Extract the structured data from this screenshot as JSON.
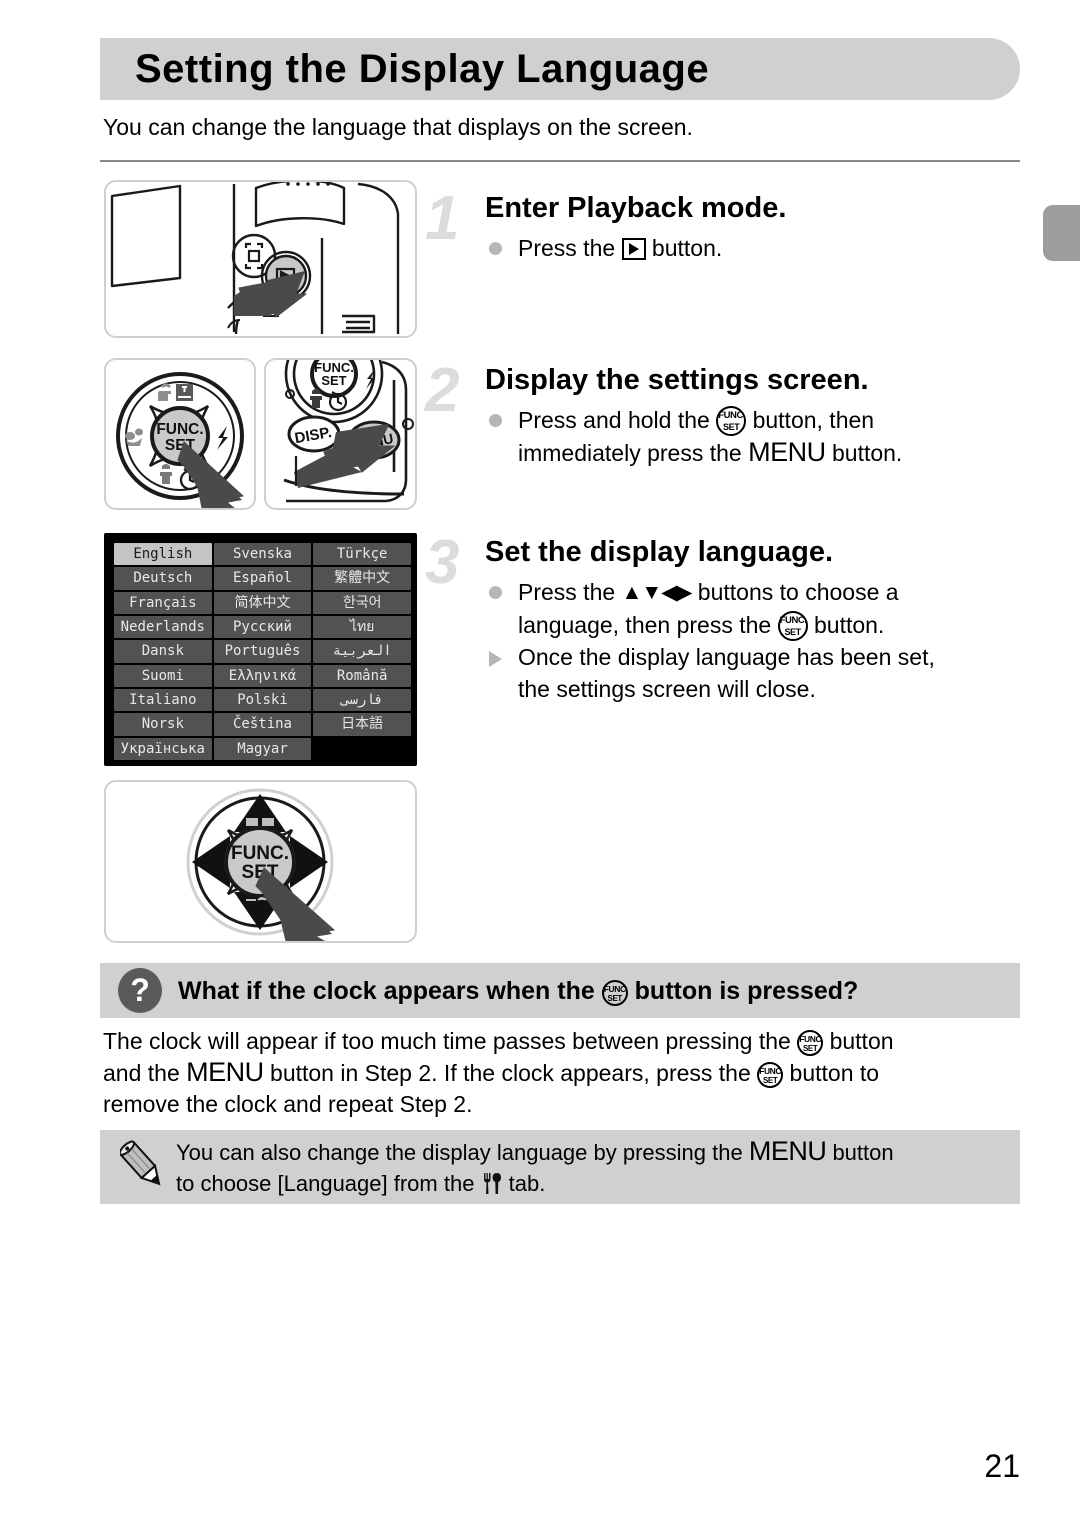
{
  "page": {
    "title": "Setting the Display Language",
    "intro": "You can change the language that displays on the screen.",
    "number": "21"
  },
  "colors": {
    "header_bar": "#d0d0d0",
    "edge_tab": "#9d9d9d",
    "step_number": "#dcdcdc",
    "bullet": "#b6b6b6",
    "lcd_background": "#000000",
    "lcd_cell": "#525252",
    "lcd_cell_selected": "#c4c4c4",
    "rule": "#8a8a8a"
  },
  "steps": [
    {
      "number": "1",
      "heading": "Enter Playback mode.",
      "lines": [
        {
          "marker": "dot",
          "pre": "Press the ",
          "icon": "playback-icon",
          "post": " button."
        }
      ]
    },
    {
      "number": "2",
      "heading": "Display the settings screen.",
      "lines": [
        {
          "marker": "dot",
          "pre": "Press and hold the ",
          "icon": "func-set-icon",
          "post": " button, then"
        },
        {
          "marker": "none",
          "pre": "immediately press the ",
          "icon": "menu-word",
          "post": " button."
        }
      ]
    },
    {
      "number": "3",
      "heading": "Set the display language.",
      "lines": [
        {
          "marker": "dot",
          "pre": "Press the ",
          "icon": "updownleftright-arrows",
          "post": " buttons to choose a"
        },
        {
          "marker": "none",
          "pre": "language, then press the ",
          "icon": "func-set-icon",
          "post": " button."
        },
        {
          "marker": "triangle",
          "pre": "Once the display language has been set,",
          "icon": "",
          "post": ""
        },
        {
          "marker": "none",
          "pre": "the settings screen will close.",
          "icon": "",
          "post": ""
        }
      ]
    }
  ],
  "step_text": {
    "s1_head": "Enter Playback mode.",
    "s1_l1a": "Press the ",
    "s1_l1b": " button.",
    "s2_head": "Display the settings screen.",
    "s2_l1a": "Press and hold the ",
    "s2_l1b": " button, then",
    "s2_l2a": "immediately press the ",
    "s2_l2b": "MENU",
    "s2_l2c": " button.",
    "s3_head": "Set the display language.",
    "s3_l1a": "Press the ",
    "s3_l1b": "▲▼◀▶",
    "s3_l1c": " buttons to choose a",
    "s3_l2a": "language, then press the ",
    "s3_l2b": " button.",
    "s3_l3": "Once the display language has been set,",
    "s3_l4": "the settings screen will close."
  },
  "language_screen": {
    "selected": "English",
    "cells": [
      "English",
      "Svenska",
      "Türkçe",
      "Deutsch",
      "Español",
      "繁體中文",
      "Français",
      "简体中文",
      "한국어",
      "Nederlands",
      "Русский",
      "ไทย",
      "Dansk",
      "Português",
      "العربية",
      "Suomi",
      "Ελληνικά",
      "Română",
      "Italiano",
      "Polski",
      "فارسی",
      "Norsk",
      "Čeština",
      "日本語",
      "Українська",
      "Magyar",
      ""
    ]
  },
  "faq": {
    "icon": "question-mark-icon",
    "title_a": "What if the clock appears when the ",
    "title_b": " button is pressed?",
    "body_a": "The clock will appear if too much time passes between pressing the ",
    "body_b": " button",
    "body_c": "and the ",
    "body_d": "MENU",
    "body_e": " button in Step 2. If the clock appears, press the ",
    "body_f": " button to",
    "body_g": "remove the clock and repeat Step 2."
  },
  "note": {
    "icon": "pencil-icon",
    "line1_a": "You can also change the display language by pressing the ",
    "line1_b": "MENU",
    "line1_c": " button",
    "line2_a": "to choose [Language] from the ",
    "line2_b": " tab."
  },
  "figures": {
    "playback": "camera-back-playback-button-illustration",
    "funcset": "func-set-dial-illustration",
    "menu": "menu-button-illustration",
    "language_screen": "language-selection-screen",
    "dial": "directional-pad-func-set-illustration"
  }
}
